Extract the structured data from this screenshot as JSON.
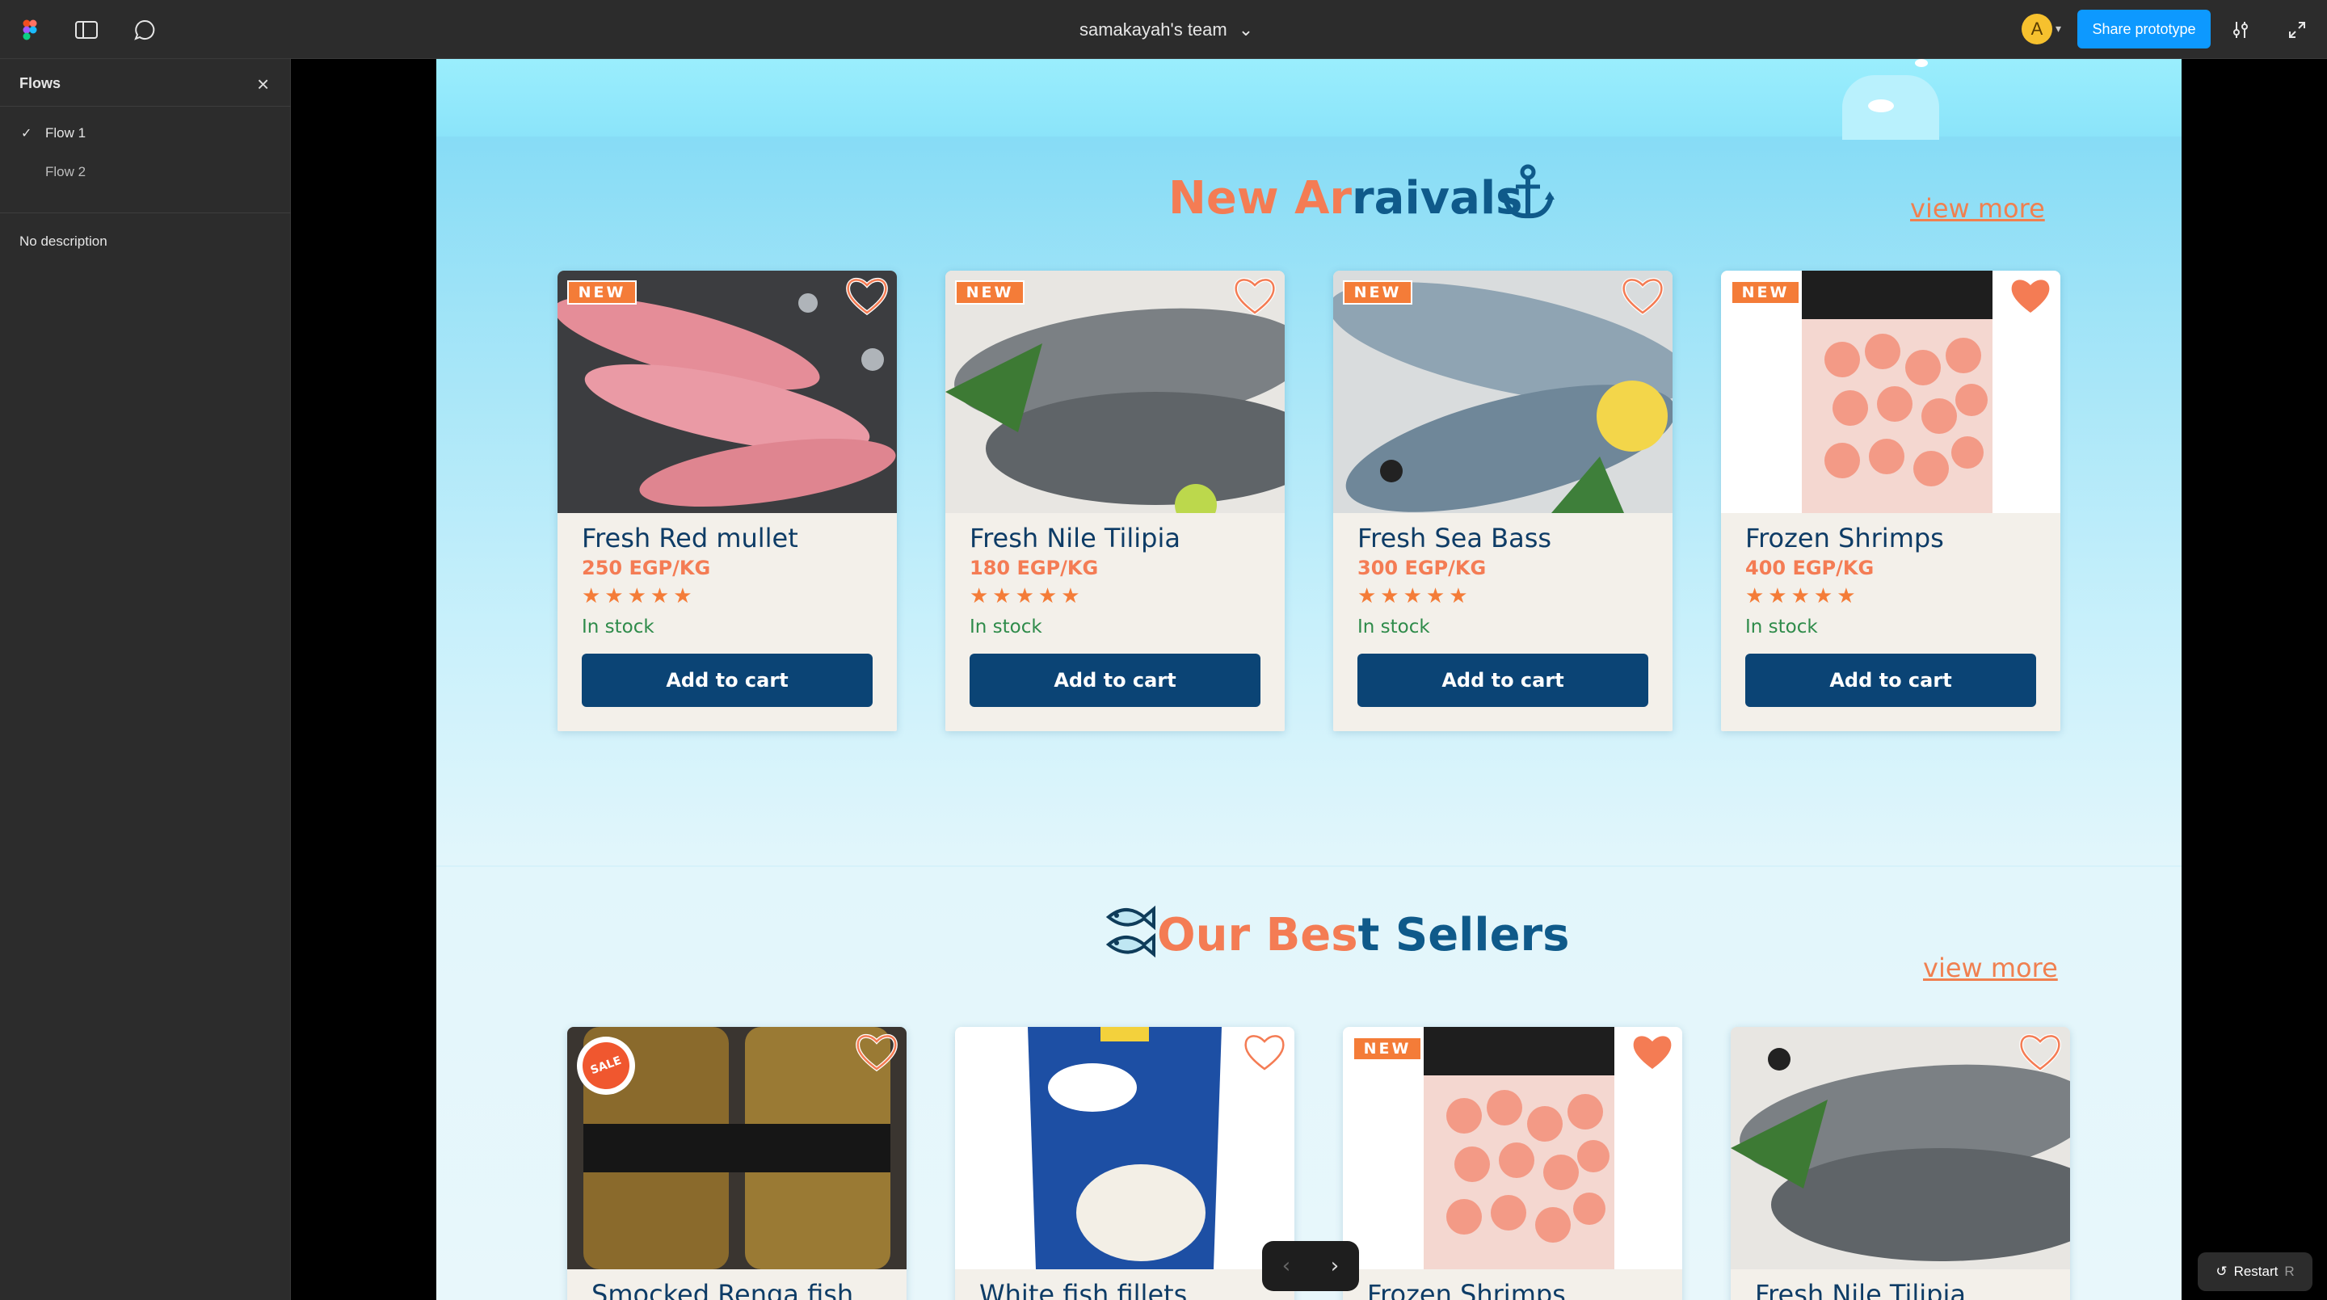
{
  "topbar": {
    "team_name": "samakayah's team",
    "avatar_letter": "A",
    "share_label": "Share prototype"
  },
  "sidebar": {
    "title": "Flows",
    "flows": [
      {
        "label": "Flow 1",
        "selected": true
      },
      {
        "label": "Flow 2",
        "selected": false
      }
    ],
    "description": "No description"
  },
  "new_arrivals": {
    "title_part1": "New Ar",
    "title_part2": "raivals",
    "view_more": "view more",
    "products": [
      {
        "name": "Fresh Red mullet",
        "price": "250 EGP/KG",
        "rating": 5,
        "stock": "In stock",
        "button": "Add to cart",
        "badge": "NEW"
      },
      {
        "name": "Fresh Nile Tilipia",
        "price": "180 EGP/KG",
        "rating": 5,
        "stock": "In stock",
        "button": "Add to cart",
        "badge": "NEW"
      },
      {
        "name": "Fresh Sea Bass",
        "price": "300 EGP/KG",
        "rating": 5,
        "stock": "In stock",
        "button": "Add to cart",
        "badge": "NEW"
      },
      {
        "name": "Frozen Shrimps",
        "price": "400 EGP/KG",
        "rating": 5,
        "stock": "In stock",
        "button": "Add to cart",
        "badge": "NEW"
      }
    ]
  },
  "best_sellers": {
    "title_part1": "Our Bes",
    "title_part2": "t Sellers",
    "view_more": "view more",
    "products": [
      {
        "name": "Smocked Renga fish",
        "badge": "SALE"
      },
      {
        "name": "White fish fillets",
        "badge": ""
      },
      {
        "name": "Frozen Shrimps",
        "badge": "NEW"
      },
      {
        "name": "Fresh Nile Tilipia",
        "badge": ""
      }
    ]
  },
  "stars_glyph": "★★★★★",
  "restart": {
    "label": "Restart",
    "key": "R"
  },
  "colors": {
    "accent": "#f47c54",
    "brand": "#0b4475",
    "share": "#0d99ff"
  }
}
